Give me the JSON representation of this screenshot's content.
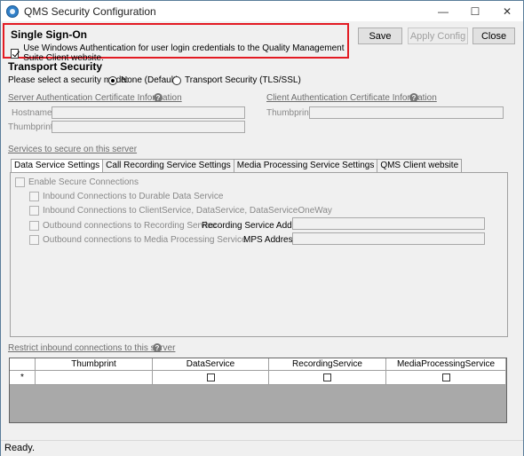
{
  "window": {
    "title": "QMS Security Configuration",
    "minimize": "—",
    "maximize": "☐",
    "close": "✕"
  },
  "sso": {
    "title": "Single Sign-On",
    "checkbox_label": "Use Windows Authentication for user login credentials to the Quality Management Suite Client website.",
    "checked": true
  },
  "buttons": {
    "save": "Save",
    "apply": "Apply Config",
    "close": "Close"
  },
  "transport": {
    "title": "Transport Security",
    "mode_prompt": "Please select a security mode:",
    "option_none": "None (Default)",
    "option_tls": "Transport Security (TLS/SSL)",
    "selected": "none"
  },
  "server_cert": {
    "title": "Server Authentication Certificate Information",
    "hostname_label": "Hostname:",
    "thumbprint_label": "Thumbprint:"
  },
  "client_cert": {
    "title": "Client Authentication Certificate Information",
    "thumbprint_label": "Thumbprint:"
  },
  "services_title": "Services to secure on this server",
  "tabs": [
    {
      "label": "Data Service Settings",
      "active": true
    },
    {
      "label": "Call Recording Service Settings",
      "active": false
    },
    {
      "label": "Media Processing Service Settings",
      "active": false
    },
    {
      "label": "QMS Client website",
      "active": false
    }
  ],
  "data_service": {
    "enable_secure": "Enable Secure Connections",
    "inbound_durable": "Inbound Connections to Durable Data Service",
    "inbound_client": "Inbound Connections to ClientService, DataService, DataServiceOneWay",
    "outbound_recording": "Outbound connections to Recording Service",
    "recording_address_label": "Recording Service Address:",
    "outbound_mps": "Outbound connections to Media Processing Service",
    "mps_address_label": "MPS Address:"
  },
  "restrict": {
    "title": "Restrict inbound connections to this server",
    "columns": [
      "Thumbprint",
      "DataService",
      "RecordingService",
      "MediaProcessingService"
    ],
    "new_row_marker": "*"
  },
  "status": "Ready."
}
